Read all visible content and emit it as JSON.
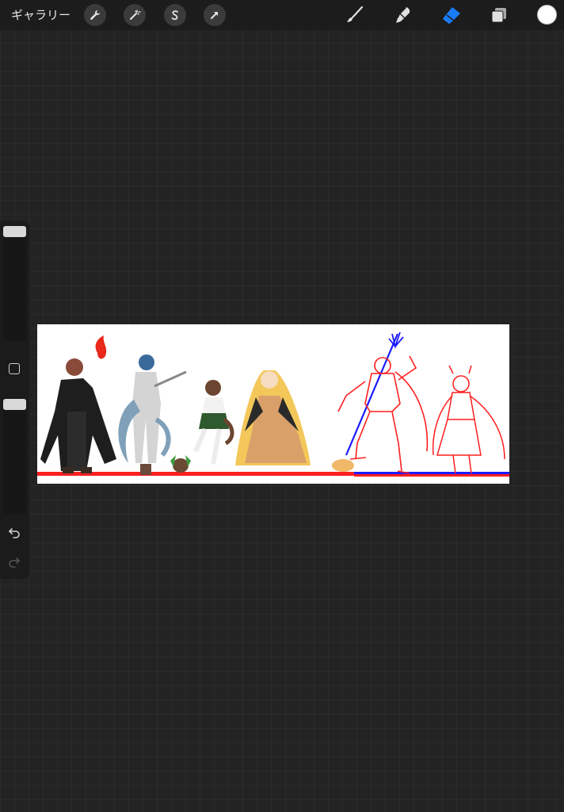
{
  "topbar": {
    "gallery_label": "ギャラリー",
    "actions": [
      {
        "name": "wrench-icon"
      },
      {
        "name": "magic-wand-icon"
      },
      {
        "name": "selection-s-icon"
      },
      {
        "name": "transform-arrow-icon"
      }
    ],
    "tools": [
      {
        "name": "brush-icon",
        "active": false
      },
      {
        "name": "smudge-icon",
        "active": false
      },
      {
        "name": "eraser-icon",
        "active": true
      },
      {
        "name": "layers-icon",
        "active": false
      }
    ],
    "current_color": "#ffffff"
  },
  "sidebar": {
    "brush_size_level": 1.0,
    "opacity_level": 1.0,
    "icons": [
      "modify-square-icon",
      "undo-icon",
      "redo-icon"
    ]
  },
  "colors": {
    "background": "#232323",
    "toolbar": "#1c1c1c",
    "active_tool": "#1a7cf5",
    "canvas": "#ffffff",
    "sketch_red": "#ff1f1f",
    "sketch_blue": "#1a1aff"
  }
}
